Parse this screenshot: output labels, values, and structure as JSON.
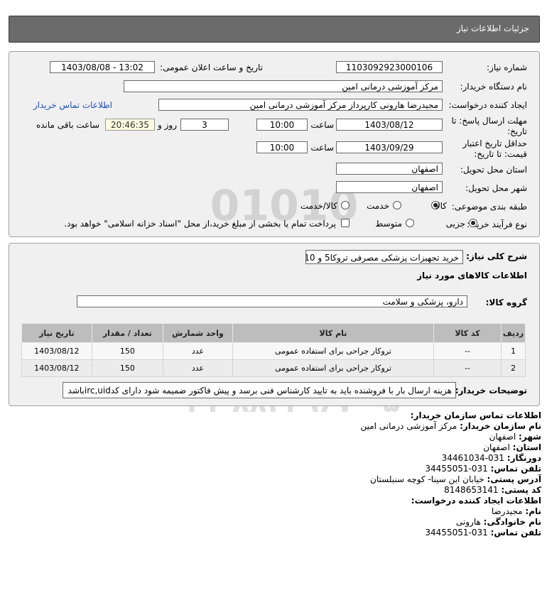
{
  "header": {
    "title": "جزئیات اطلاعات نیاز"
  },
  "form": {
    "need_number_label": "شماره نیاز:",
    "need_number": "1103092923000106",
    "announce_label": "تاریخ و ساعت اعلان عمومی:",
    "announce_value": "1403/08/08 - 13:02",
    "buyer_name_label": "نام دستگاه خریدار:",
    "buyer_name": "مرکز آموزشی درمانی امین",
    "creator_label": "ایجاد کننده درخواست:",
    "creator": "مجیدرضا هارونی کارپرداز مرکز آموزشی درمانی امین",
    "contact_link": "اطلاعات تماس خریدار",
    "deadline_label": "مهلت ارسال پاسخ: تا تاریخ:",
    "deadline_date": "1403/08/12",
    "time_label": "ساعت",
    "deadline_time": "10:00",
    "days_value": "3",
    "days_label": "روز و",
    "remaining_timer": "20:46:35",
    "remaining_label": "ساعت باقی مانده",
    "validity_label": "حداقل تاریخ اعتبار قیمت: تا تاریخ:",
    "validity_date": "1403/09/29",
    "validity_time": "10:00",
    "province_label": "استان محل تحویل:",
    "province": "اصفهان",
    "city_label": "شهر محل تحویل:",
    "city": "اصفهان",
    "category_label": "طبقه بندی موضوعی:",
    "category_options": [
      "کالا",
      "خدمت",
      "کالا/خدمت"
    ],
    "category_selected": "کالا",
    "process_label": "نوع فرآیند خرید :",
    "process_options": [
      "جزیی",
      "متوسط"
    ],
    "process_selected": "جزیی",
    "treasury_note": "پرداخت تمام یا بخشی از مبلغ خرید،از محل \"اسناد خزانه اسلامی\" خواهد بود."
  },
  "details": {
    "summary_label": "شرح کلی نیاز:",
    "summary": "خرید تجهیزات پزشکی مصرفی تروکا5 و 10",
    "goods_info_title": "اطلاعات کالاهای مورد نیاز",
    "goods_group_label": "گروه کالا:",
    "goods_group": "دارو، پزشکی و سلامت",
    "table": {
      "headers": [
        "ردیف",
        "کد کالا",
        "نام کالا",
        "واحد شمارش",
        "تعداد / مقدار",
        "تاریخ نیاز"
      ],
      "rows": [
        [
          "1",
          "--",
          "تروکار جراحی برای استفاده عمومی",
          "عدد",
          "150",
          "1403/08/12"
        ],
        [
          "2",
          "--",
          "تروکار جراحی برای استفاده عمومی",
          "عدد",
          "150",
          "1403/08/12"
        ]
      ]
    },
    "buyer_notes_label": "توضیحات خریدار:",
    "buyer_notes": "هزینه ارسال بار با فروشنده باید به تایید کارشناس فنی برسد و پیش فاکتور ضمیمه شود دارای کدirc,uidباشد"
  },
  "contact": {
    "title": "اطلاعات تماس سازمان خریدار:",
    "org_name_label": "نام سازمان خریدار:",
    "org_name": "مرکز آموزشی درمانی امین",
    "city_label": "شهر:",
    "city": "اصفهان",
    "province_label": "استان:",
    "province": "اصفهان",
    "fax_label": "دورنگار:",
    "fax": "031-34461034",
    "phone_label": "تلفن تماس:",
    "phone": "031-34455051",
    "address_label": "آدرس پستی:",
    "address": "خیابان ابن سینا- کوچه سنبلستان",
    "postal_label": "کد پستی:",
    "postal": "8148653141",
    "creator_title": "اطلاعات ایجاد کننده درخواست:",
    "first_name_label": "نام:",
    "first_name": "مجیدرضا",
    "last_name_label": "نام خانوادگی:",
    "last_name": "هارونی",
    "creator_phone_label": "تلفن تماس:",
    "creator_phone": "031-34455051"
  },
  "watermark": {
    "site": "ParsNamadData",
    "phone": "۰۲۱-۸۸۳۴۹۶۷۰-۵"
  }
}
